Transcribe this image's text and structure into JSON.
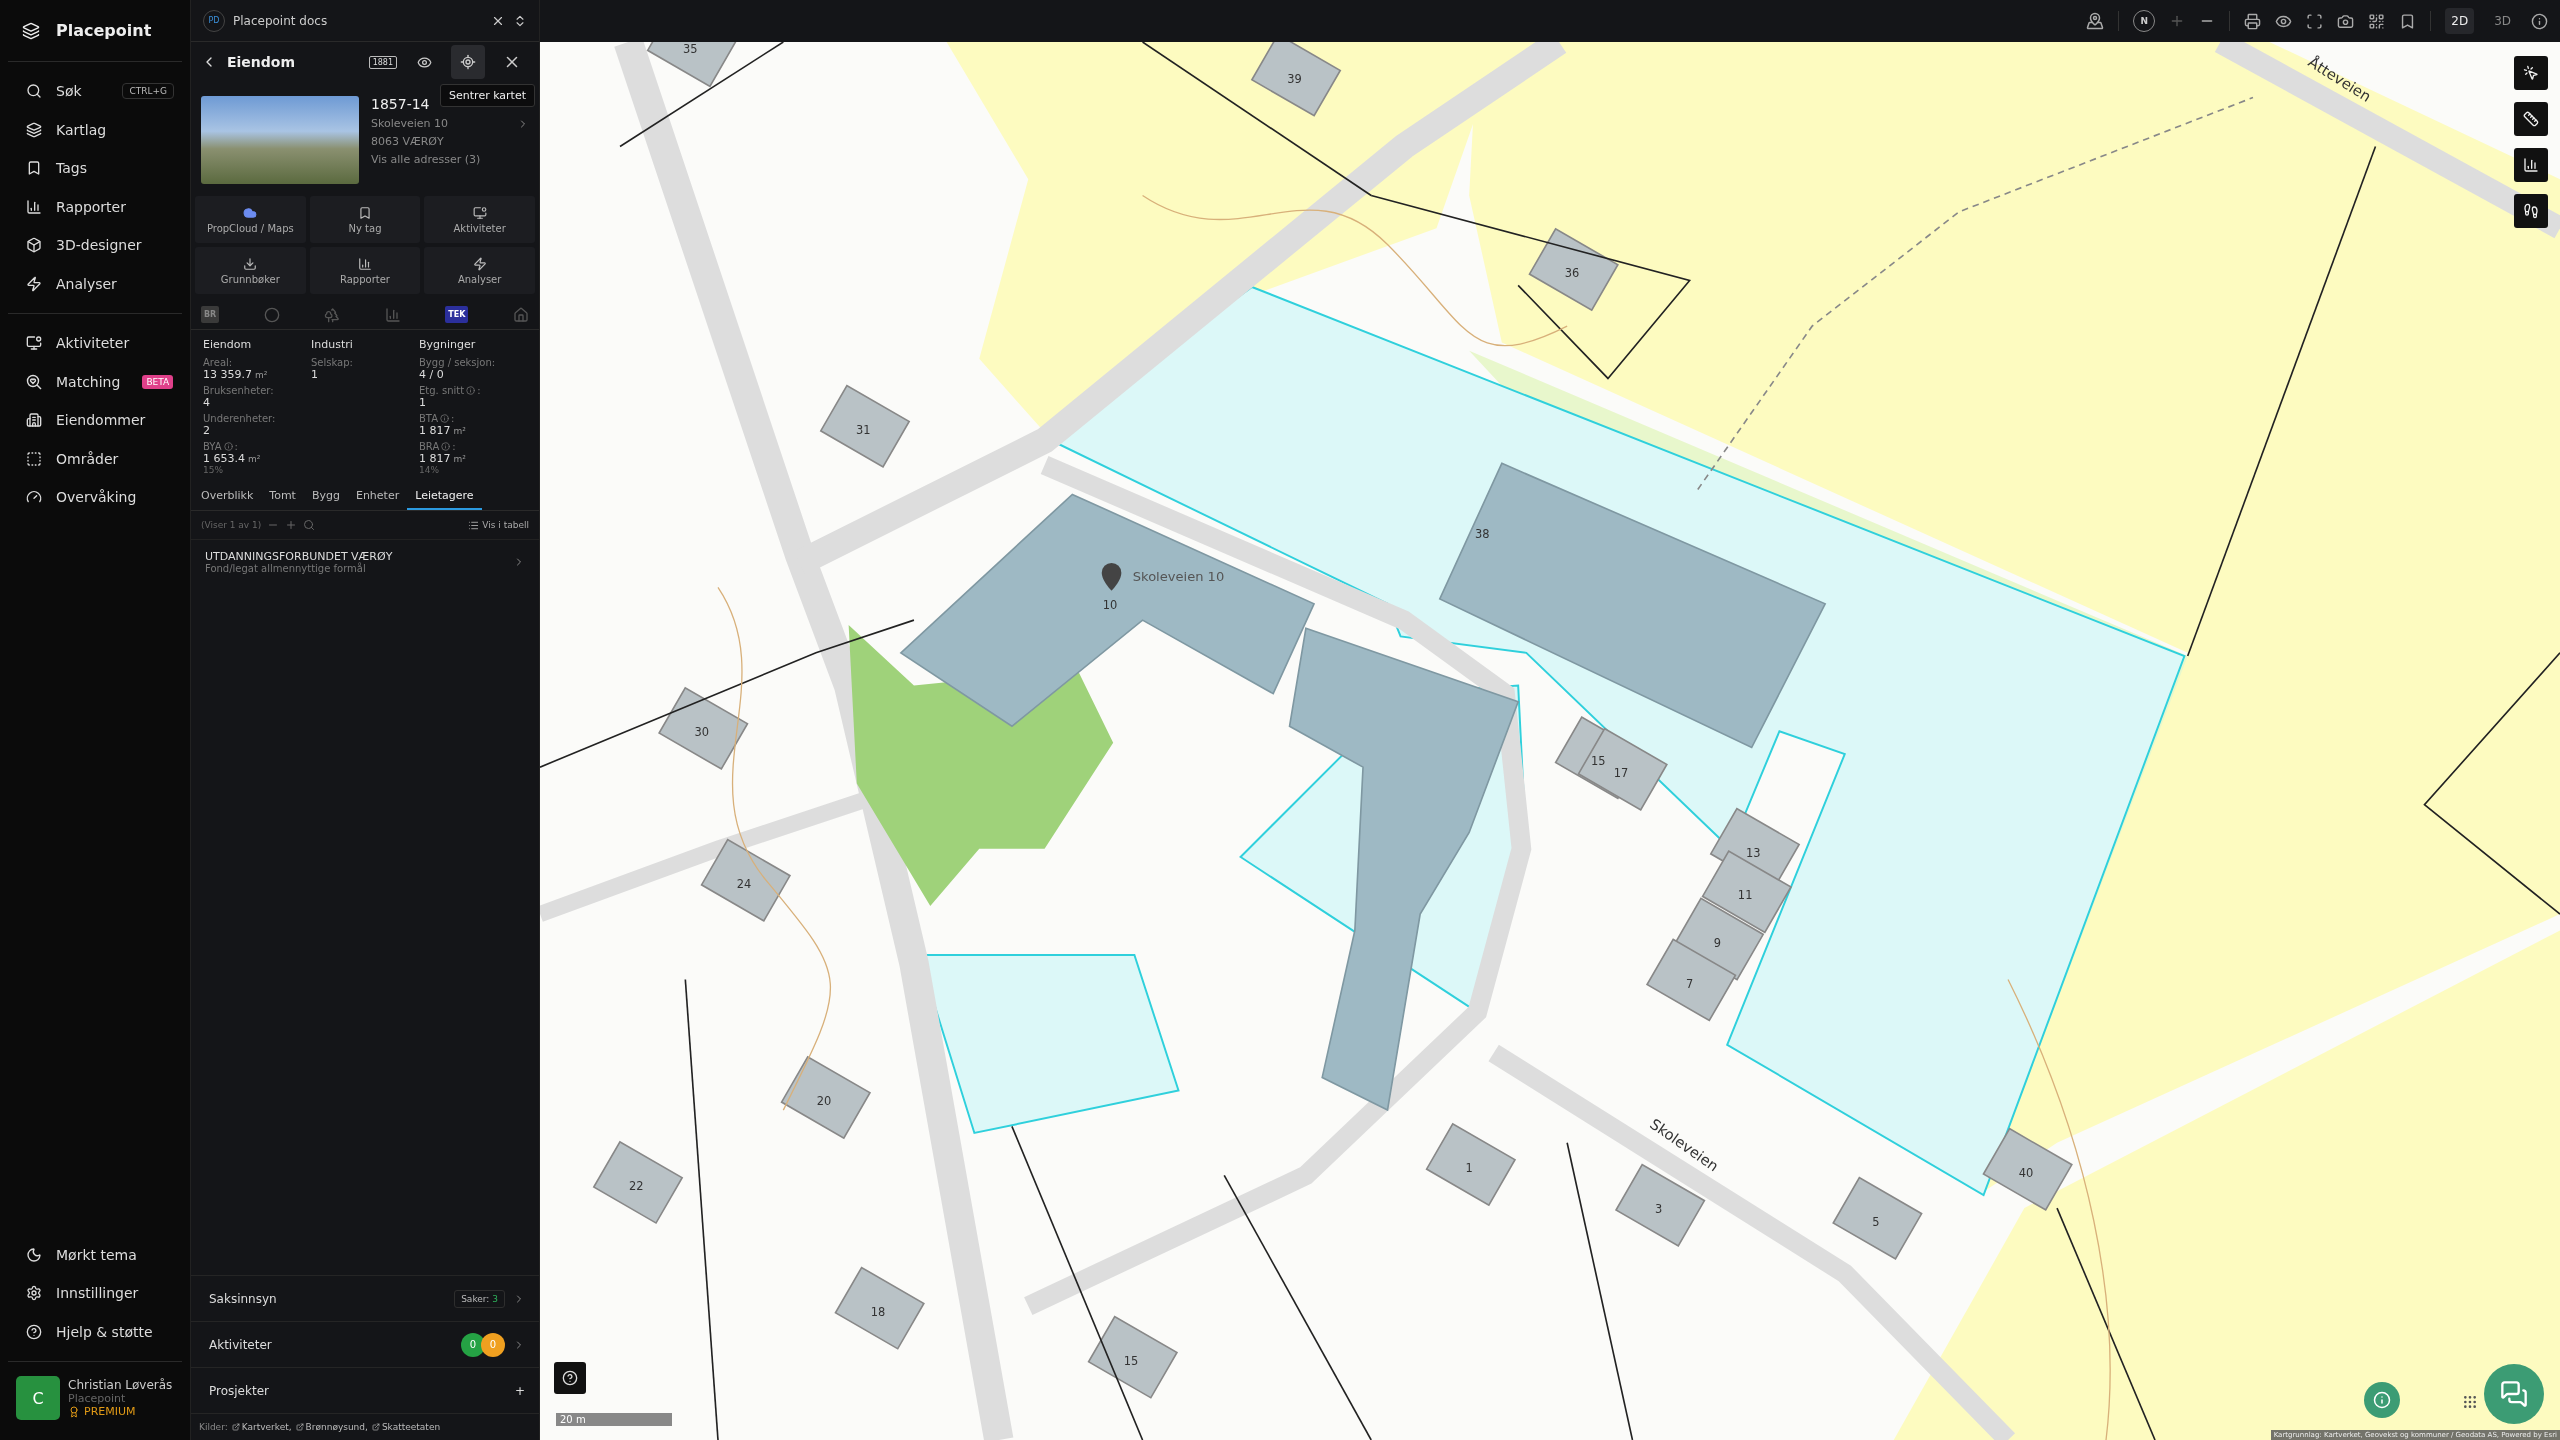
{
  "nav": {
    "brand": "Placepoint",
    "primary": [
      {
        "label": "Søk",
        "shortcut": "CTRL+G"
      },
      {
        "label": "Kartlag"
      },
      {
        "label": "Tags"
      },
      {
        "label": "Rapporter"
      },
      {
        "label": "3D-designer"
      },
      {
        "label": "Analyser"
      }
    ],
    "secondary": [
      {
        "label": "Aktiviteter"
      },
      {
        "label": "Matching",
        "badge": "BETA"
      },
      {
        "label": "Eiendommer"
      },
      {
        "label": "Områder"
      },
      {
        "label": "Overvåking"
      }
    ],
    "footer": [
      {
        "label": "Mørkt tema"
      },
      {
        "label": "Innstillinger"
      },
      {
        "label": "Hjelp & støtte"
      }
    ],
    "user": {
      "initial": "C",
      "name": "Christian Løverås",
      "org": "Placepoint",
      "plan": "PREMIUM"
    }
  },
  "panel": {
    "workspace": {
      "initials": "PD",
      "name": "Placepoint docs"
    },
    "header": {
      "title": "Eiendom",
      "badge": "1881",
      "tooltip": "Sentrer kartet"
    },
    "property": {
      "id": "1857-14",
      "address": "Skoleveien 10",
      "postal": "8063 VÆRØY",
      "all_addresses": "Vis alle adresser (3)"
    },
    "actions": [
      "PropCloud / Maps",
      "Ny tag",
      "Aktiviteter",
      "Grunnbøker",
      "Rapporter",
      "Analyser"
    ],
    "strip": [
      {
        "kind": "text",
        "label": "BR"
      },
      {
        "kind": "icon"
      },
      {
        "kind": "icon"
      },
      {
        "kind": "icon"
      },
      {
        "kind": "tek",
        "label": "TEK"
      },
      {
        "kind": "icon"
      }
    ],
    "facts": [
      {
        "heading": "Eiendom",
        "fields": [
          {
            "label": "Areal:",
            "value": "13 359.7",
            "unit": "m²"
          },
          {
            "label": "Bruksenheter:",
            "value": "4"
          },
          {
            "label": "Underenheter:",
            "value": "2"
          },
          {
            "label": "BYA",
            "info": true,
            "colon": ":",
            "value": "1 653.4",
            "unit": "m²",
            "sub": "15%"
          }
        ]
      },
      {
        "heading": "Industri",
        "fields": [
          {
            "label": "Selskap:",
            "value": "1"
          }
        ]
      },
      {
        "heading": "Bygninger",
        "fields": [
          {
            "label": "Bygg / seksjon:",
            "value": "4 / 0"
          },
          {
            "label": "Etg. snitt",
            "info": true,
            "colon": ":",
            "value": "1"
          },
          {
            "label": "BTA",
            "info": true,
            "colon": ":",
            "value": "1 817",
            "unit": "m²"
          },
          {
            "label": "BRA",
            "info": true,
            "colon": ":",
            "value": "1 817",
            "unit": "m²",
            "sub": "14%"
          }
        ]
      }
    ],
    "tabs": [
      {
        "label": "Overblikk",
        "selected": false
      },
      {
        "label": "Tomt",
        "selected": false
      },
      {
        "label": "Bygg",
        "selected": false
      },
      {
        "label": "Enheter",
        "selected": false
      },
      {
        "label": "Leietagere",
        "selected": true
      }
    ],
    "list_toolbar": {
      "count": "(Viser 1 av 1)",
      "table_link": "Vis i tabell"
    },
    "tenants": [
      {
        "name": "UTDANNINGSFORBUNDET VÆRØY",
        "category": "Fond/legat allmennyttige formål"
      }
    ],
    "sections": [
      {
        "kind": "cases",
        "title": "Saksinnsyn",
        "label": "Saker:",
        "count": "3"
      },
      {
        "kind": "activities",
        "title": "Aktiviteter",
        "counts": [
          "0",
          "0"
        ]
      },
      {
        "kind": "add",
        "title": "Prosjekter",
        "action": "+"
      }
    ],
    "sources": {
      "label": "Kilder:",
      "links": [
        "Kartverket,",
        "Brønnøysund,",
        "Skatteetaten"
      ]
    }
  },
  "map": {
    "modes": [
      {
        "label": "2D",
        "selected": true
      },
      {
        "label": "3D",
        "selected": false
      }
    ],
    "compass": "N",
    "roads": [
      "Åtteveien",
      "Skoleveien"
    ],
    "marker": "Skoleveien 10",
    "house_numbers": [
      "35",
      "39",
      "36",
      "31",
      "38",
      "10",
      "30",
      "15",
      "17",
      "13",
      "11",
      "9",
      "7",
      "24",
      "20",
      "22",
      "1",
      "3",
      "5",
      "40",
      "18",
      "15"
    ],
    "scale": "20 m",
    "attribution": "Kartgrunnlag: Kartverket, Geovekst og kommuner / Geodata AS, Powered by Esri"
  }
}
